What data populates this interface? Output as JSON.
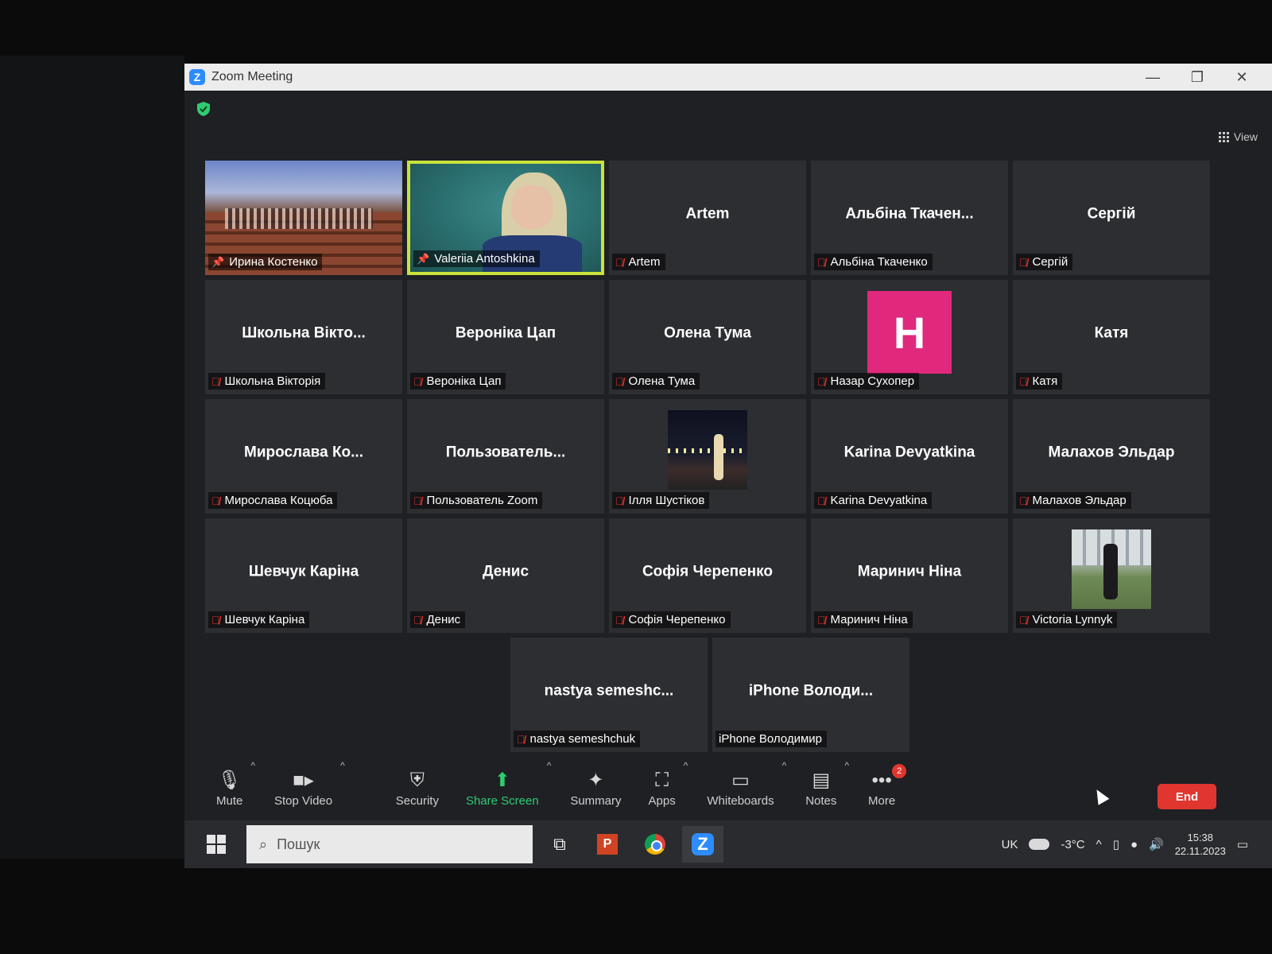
{
  "window": {
    "title": "Zoom Meeting",
    "minimize": "—",
    "restore": "❐",
    "close": "✕"
  },
  "view_label": "View",
  "tiles_rows": [
    [
      {
        "type": "video_room",
        "label": "Ирина Костенко",
        "pin": true
      },
      {
        "type": "video_face",
        "label": "Valeriia Antoshkina",
        "pin": true,
        "active": true
      },
      {
        "type": "name",
        "big": "Artem",
        "label": "Artem",
        "muted": true
      },
      {
        "type": "name",
        "big": "Альбіна Ткачен...",
        "label": "Альбіна Ткаченко",
        "muted": true
      },
      {
        "type": "name",
        "big": "Сергій",
        "label": "Сергій",
        "muted": true
      }
    ],
    [
      {
        "type": "name",
        "big": "Школьна Вікто...",
        "label": "Школьна Вікторія",
        "muted": true
      },
      {
        "type": "name",
        "big": "Вероніка Цап",
        "label": "Вероніка Цап",
        "muted": true
      },
      {
        "type": "name",
        "big": "Олена Тума",
        "label": "Олена Тума",
        "muted": true
      },
      {
        "type": "avatar",
        "avatar_letter": "H",
        "avatar_color": "#e0297c",
        "label": "Назар Сухопер",
        "muted": true
      },
      {
        "type": "name",
        "big": "Катя",
        "label": "Катя",
        "muted": true
      }
    ],
    [
      {
        "type": "name",
        "big": "Мирослава Ко...",
        "label": "Мирослава Коцюба",
        "muted": true
      },
      {
        "type": "name",
        "big": "Пользователь...",
        "label": "Пользователь Zoom",
        "muted": true
      },
      {
        "type": "thumb_night",
        "label": "Ілля Шустіков",
        "muted": true
      },
      {
        "type": "name",
        "big": "Karina Devyatkina",
        "label": "Karina Devyatkina",
        "muted": true
      },
      {
        "type": "name",
        "big": "Малахов Эльдар",
        "label": "Малахов Эльдар",
        "muted": true
      }
    ],
    [
      {
        "type": "name",
        "big": "Шевчук Каріна",
        "label": "Шевчук Каріна",
        "muted": true
      },
      {
        "type": "name",
        "big": "Денис",
        "label": "Денис",
        "muted": true
      },
      {
        "type": "name",
        "big": "Софія Черепенко",
        "label": "Софія Черепенко",
        "muted": true
      },
      {
        "type": "name",
        "big": "Маринич Ніна",
        "label": "Маринич Ніна",
        "muted": true
      },
      {
        "type": "thumb_day",
        "label": "Victoria Lynnyk",
        "muted": true
      }
    ],
    [
      {
        "type": "name",
        "big": "nastya semeshc...",
        "label": "nastya semeshchuk",
        "muted": true
      },
      {
        "type": "name",
        "big": "iPhone Володи...",
        "label": "iPhone Володимир",
        "muted": false
      }
    ]
  ],
  "toolbar": {
    "mute": "Mute",
    "stop_video": "Stop Video",
    "security": "Security",
    "share_screen": "Share Screen",
    "summary": "Summary",
    "apps": "Apps",
    "whiteboards": "Whiteboards",
    "notes": "Notes",
    "more": "More",
    "more_badge": "2",
    "end": "End"
  },
  "taskbar": {
    "search_placeholder": "Пошук",
    "lang": "UK",
    "weather_badge": "1",
    "temperature": "-3°C",
    "time": "15:38",
    "date": "22.11.2023"
  },
  "colors": {
    "active_border": "#c9e33c",
    "end": "#e0362f",
    "share": "#2ecc71",
    "zoom_blue": "#2d8cff"
  }
}
